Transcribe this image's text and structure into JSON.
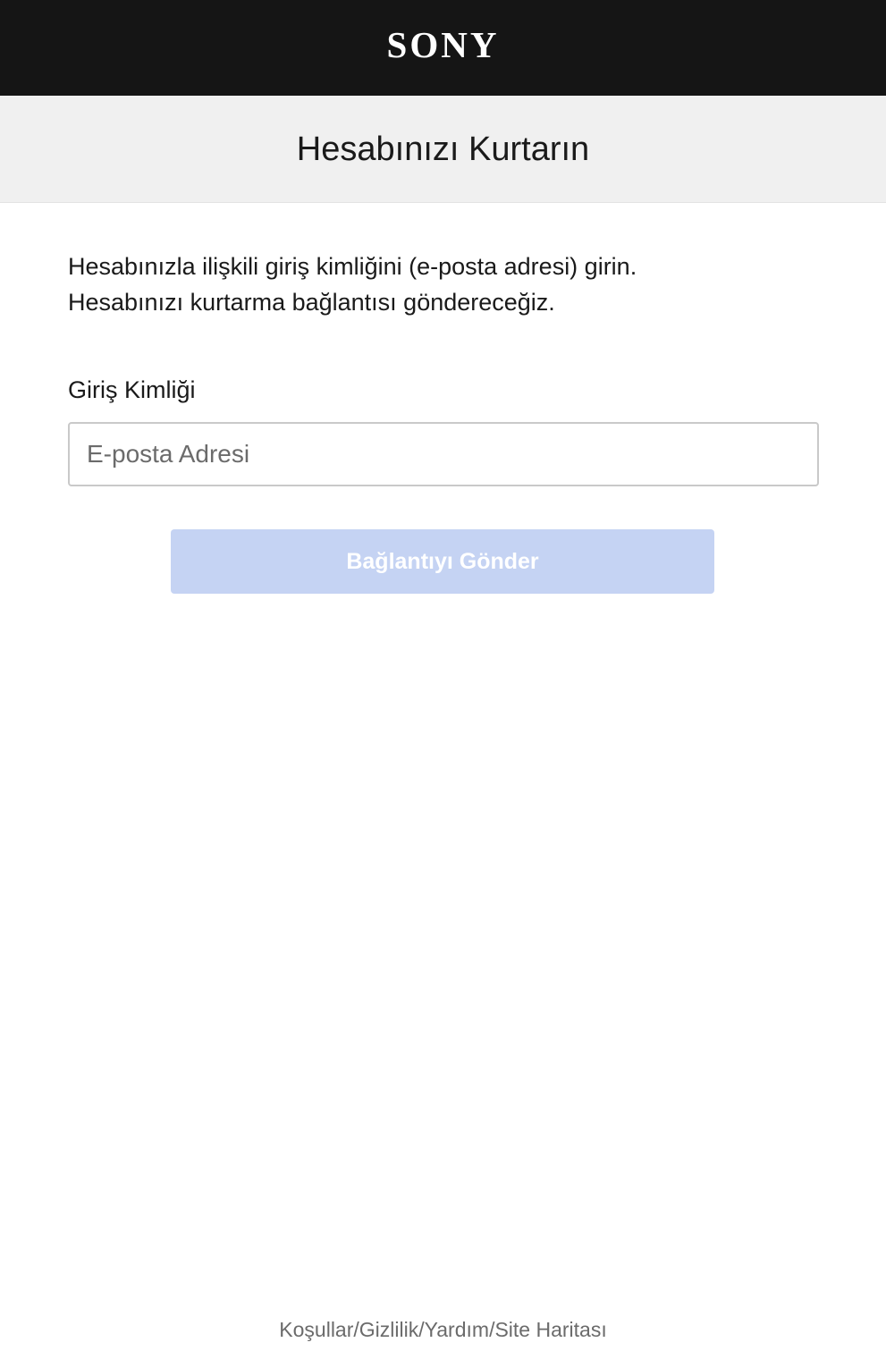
{
  "header": {
    "logo_text": "SONY"
  },
  "title_band": {
    "title": "Hesabınızı Kurtarın"
  },
  "main": {
    "intro_line1": "Hesabınızla ilişkili giriş kimliğini (e-posta adresi) girin.",
    "intro_line2": "Hesabınızı kurtarma bağlantısı göndereceğiz.",
    "field_label": "Giriş Kimliği",
    "email_value": "",
    "email_placeholder": "E-posta Adresi",
    "send_label": "Bağlantıyı Gönder"
  },
  "footer": {
    "links": [
      {
        "label": "Koşullar"
      },
      {
        "label": "Gizlilik"
      },
      {
        "label": "Yardım"
      },
      {
        "label": "Site Haritası"
      }
    ],
    "separator": "/"
  },
  "colors": {
    "header_bg": "#151515",
    "title_band_bg": "#f0f0f0",
    "button_disabled_bg": "#c5d3f3",
    "text": "#1a1a1a",
    "muted_text": "#6b6b6b"
  }
}
